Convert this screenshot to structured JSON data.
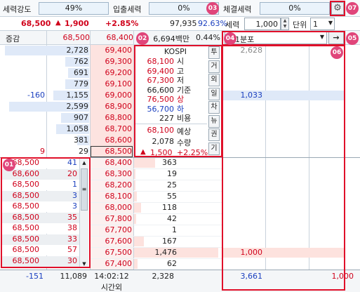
{
  "header": {
    "strength_label": "세력강도",
    "strength_value": "49%",
    "inout_label": "입출세력",
    "inout_value": "0%",
    "trade_label": "체결세력",
    "trade_value": "0%"
  },
  "quote": {
    "price": "68,500",
    "change_arrow": "▲",
    "change": "1,900",
    "rate": "+2.85%",
    "volume": "97,935",
    "volume_pct": "92.63%"
  },
  "sub_header": {
    "label_jeunggam": "증감",
    "ask_total": "68,500",
    "price_first": "68,400",
    "amount": "6,694백만",
    "amount_pct": "0.44%"
  },
  "controls": {
    "seryeok_label": "세력",
    "seryeok_value": "1,000",
    "danwi_label": "단위",
    "danwi_value": "1",
    "interval_value": "1분포",
    "go_arrow": "→"
  },
  "asks": [
    {
      "diff": "",
      "qty": "2,728",
      "price": "69,400"
    },
    {
      "diff": "",
      "qty": "762",
      "price": "69,300"
    },
    {
      "diff": "",
      "qty": "691",
      "price": "69,200"
    },
    {
      "diff": "",
      "qty": "779",
      "price": "69,100"
    },
    {
      "diff": "-160",
      "qty": "1,155",
      "price": "69,000"
    },
    {
      "diff": "",
      "qty": "2,599",
      "price": "68,900"
    },
    {
      "diff": "",
      "qty": "907",
      "price": "68,800"
    },
    {
      "diff": "",
      "qty": "1,058",
      "price": "68,700"
    },
    {
      "diff": "",
      "qty": "381",
      "price": "68,600"
    },
    {
      "diff": "9",
      "qty": "29",
      "price": "68,500"
    }
  ],
  "bids": [
    {
      "price": "68,400",
      "qty": "363"
    },
    {
      "price": "68,300",
      "qty": "19"
    },
    {
      "price": "68,200",
      "qty": "25"
    },
    {
      "price": "68,100",
      "qty": "55"
    },
    {
      "price": "68,000",
      "qty": "118"
    },
    {
      "price": "67,800",
      "qty": "42"
    },
    {
      "price": "67,700",
      "qty": "1"
    },
    {
      "price": "67,600",
      "qty": "167"
    },
    {
      "price": "67,500",
      "qty": "1,476"
    },
    {
      "price": "67,400",
      "qty": "62"
    }
  ],
  "ticks": [
    {
      "price": "68,500",
      "qty": "41"
    },
    {
      "price": "68,600",
      "qty": "20"
    },
    {
      "price": "68,500",
      "qty": "1"
    },
    {
      "price": "68,500",
      "qty": "3"
    },
    {
      "price": "68,500",
      "qty": "3"
    },
    {
      "price": "68,500",
      "qty": "35"
    },
    {
      "price": "68,500",
      "qty": "38"
    },
    {
      "price": "68,500",
      "qty": "33"
    },
    {
      "price": "68,500",
      "qty": "57"
    },
    {
      "price": "68,500",
      "qty": "30"
    }
  ],
  "info": {
    "index_name": "KOSPI",
    "rows": [
      {
        "value": "68,100",
        "label": "시"
      },
      {
        "value": "69,400",
        "label": "고"
      },
      {
        "value": "67,300",
        "label": "저"
      },
      {
        "value": "66,600",
        "label": "기준"
      },
      {
        "value": "76,500",
        "label": "상"
      },
      {
        "value": "56,700",
        "label": "하"
      },
      {
        "value": "227",
        "label": "비용"
      }
    ],
    "expected_price": "68,100",
    "expected_label": "예상",
    "expected_qty": "2,078",
    "expected_qty_label": "수량",
    "expected_change": "1,500",
    "expected_rate": "+2.25%"
  },
  "side_tabs": [
    "투",
    "거",
    "외",
    "일",
    "차",
    "뉴",
    "권",
    "기"
  ],
  "dist": [
    {
      "value": "2,628",
      "row": 0
    },
    {
      "value": "1,033",
      "row": 4
    },
    {
      "value": "1,000",
      "row": 18
    }
  ],
  "footer": {
    "ask_diff": "-151",
    "ask_total": "11,089",
    "time": "14:02:12",
    "time_label": "시간외",
    "bid_total": "2,328",
    "dist_total": "3,661",
    "dist_right": "1,000"
  },
  "callouts": [
    "01",
    "02",
    "03",
    "04",
    "05",
    "06",
    "07"
  ],
  "icons": {
    "settings": "gear-icon"
  }
}
